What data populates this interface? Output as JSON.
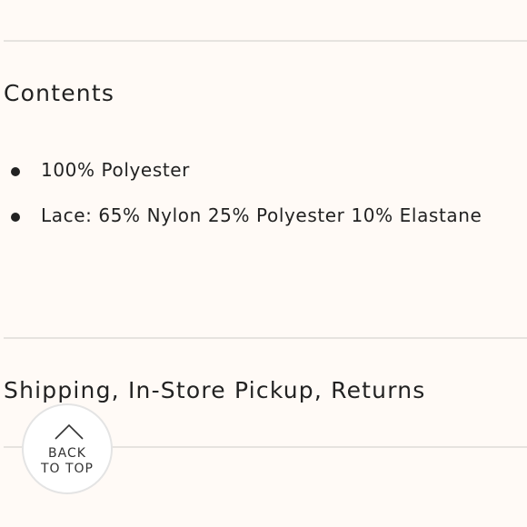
{
  "contents": {
    "title": "Contents",
    "items": [
      {
        "text": "100% Polyester"
      },
      {
        "text": "Lace: 65% Nylon 25% Polyester 10% Elastane"
      }
    ]
  },
  "shipping": {
    "title": "Shipping, In-Store Pickup, Returns"
  },
  "back_to_top": {
    "line1": "BACK",
    "line2": "TO TOP",
    "icon": "chevron-up-icon"
  },
  "colors": {
    "background": "#fffaf6",
    "text": "#222222",
    "divider": "#e6e3df"
  }
}
